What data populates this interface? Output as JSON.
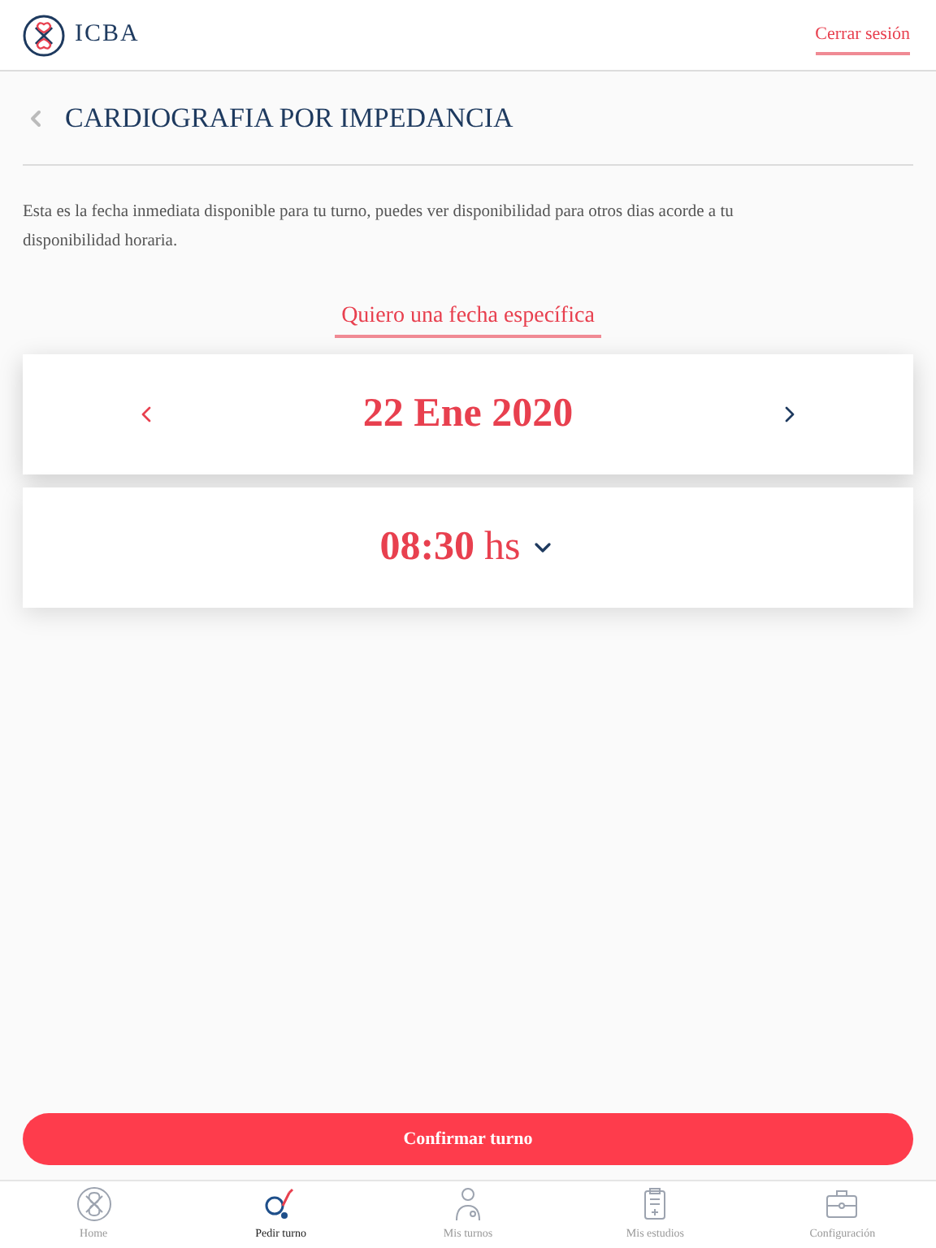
{
  "header": {
    "logo_text": "ICBA",
    "logout": "Cerrar sesión"
  },
  "page": {
    "title": "CARDIOGRAFIA POR IMPEDANCIA",
    "intro": "Esta es la fecha inmediata disponible para tu turno, puedes ver disponibilidad para otros dias acorde a tu disponibilidad horaria.",
    "specific_date_link": "Quiero una fecha específica"
  },
  "date_picker": {
    "date": "22 Ene 2020"
  },
  "time_picker": {
    "time": "08:30",
    "unit": "hs"
  },
  "confirm_button": "Confirmar turno",
  "tab_bar": [
    {
      "label": "Home",
      "kind": "home",
      "selected": false
    },
    {
      "label": "Pedir turno",
      "kind": "stethoscope",
      "selected": true
    },
    {
      "label": "Mis turnos",
      "kind": "doctor",
      "selected": false
    },
    {
      "label": "Mis estudios",
      "kind": "clipboard",
      "selected": false
    },
    {
      "label": "Configuración",
      "kind": "briefcase",
      "selected": false
    }
  ]
}
